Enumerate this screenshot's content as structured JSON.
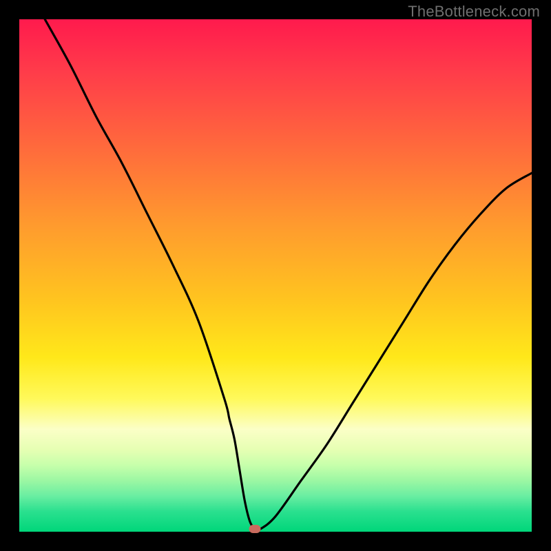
{
  "watermark": "TheBottleneck.com",
  "colors": {
    "frame": "#000000",
    "curve": "#000000",
    "marker": "#c96b5e"
  },
  "chart_data": {
    "type": "line",
    "title": "",
    "xlabel": "",
    "ylabel": "",
    "xlim": [
      0,
      100
    ],
    "ylim": [
      0,
      100
    ],
    "grid": false,
    "legend": "none",
    "series": [
      {
        "name": "bottleneck-curve",
        "x": [
          5,
          10,
          15,
          20,
          25,
          30,
          35,
          40,
          41,
          42,
          43,
          44,
          45,
          46,
          47,
          50,
          55,
          60,
          65,
          70,
          75,
          80,
          85,
          90,
          95,
          100
        ],
        "values": [
          100,
          91,
          81,
          72,
          62,
          52,
          41,
          26,
          22,
          18,
          12,
          6,
          2,
          0.5,
          0.5,
          3,
          10,
          17,
          25,
          33,
          41,
          49,
          56,
          62,
          67,
          70
        ]
      }
    ],
    "marker": {
      "x": 46,
      "y": 0.5
    },
    "background_gradient": [
      {
        "pos": 0,
        "color": "#ff1a4d"
      },
      {
        "pos": 25,
        "color": "#ff6a3c"
      },
      {
        "pos": 55,
        "color": "#ffc51f"
      },
      {
        "pos": 74,
        "color": "#fff95a"
      },
      {
        "pos": 88,
        "color": "#c7ffab"
      },
      {
        "pos": 100,
        "color": "#00d67a"
      }
    ]
  }
}
